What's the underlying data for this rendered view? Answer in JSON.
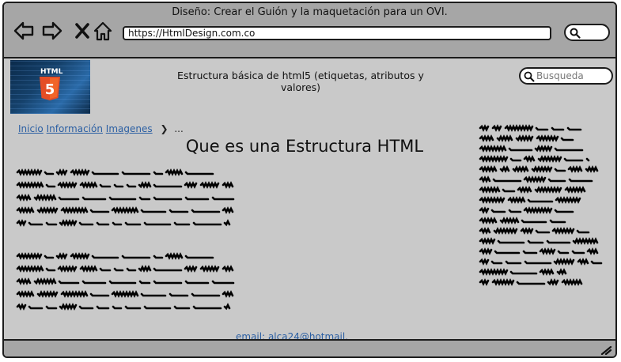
{
  "window": {
    "title": "Diseño: Crear el Guión y la maquetación para un OVI."
  },
  "browser": {
    "url": "https://HtmlDesign.com.co",
    "icons": [
      "back-arrow-icon",
      "forward-arrow-icon",
      "close-x-icon",
      "home-icon",
      "search-icon"
    ]
  },
  "header": {
    "logo_text": "HTML",
    "logo_badge": "5",
    "heading": "Estructura básica de html5 (etiquetas, atributos y valores)",
    "search_placeholder": "Busqueda"
  },
  "breadcrumb": {
    "items": [
      "Inicio",
      "Información",
      "Imagenes"
    ],
    "separator_icon": "chevron-right-icon",
    "trail": "..."
  },
  "main": {
    "title": "Que es una Estructura HTML",
    "placeholder_text": "scribbled placeholder text blocks"
  },
  "footer": {
    "email_label": "email: alca24@hotmail."
  },
  "colors": {
    "chrome": "#a6a6a6",
    "page": "#c9c9c9",
    "link": "#2b5fa3",
    "html5_orange": "#e44d26"
  }
}
